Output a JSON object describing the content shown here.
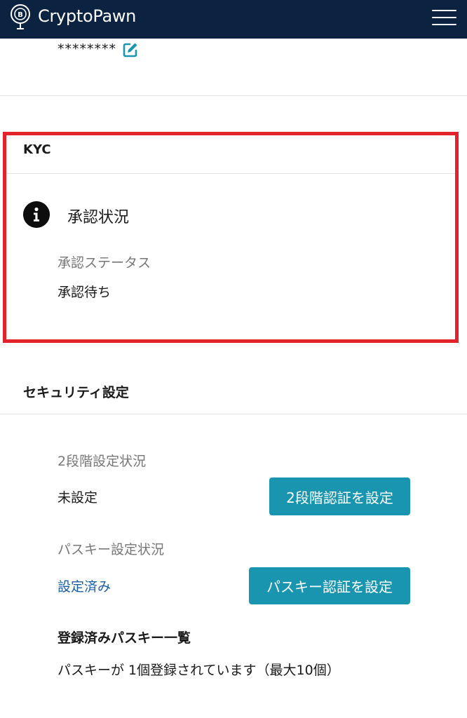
{
  "header": {
    "brand": "CryptoPawn",
    "logo_icon": "pawn-coin-logo-icon",
    "menu_icon": "hamburger-menu-icon",
    "background": "#0b2340"
  },
  "account": {
    "password_mask": "********",
    "edit_icon": "edit-pencil-icon"
  },
  "kyc": {
    "title": "KYC",
    "status_icon": "info-icon",
    "approval_heading": "承認状況",
    "approval_status_label": "承認ステータス",
    "approval_status_value": "承認待ち",
    "highlight_color": "#e3232c"
  },
  "security": {
    "title": "セキュリティ設定",
    "two_factor_label": "2段階設定状況",
    "two_factor_value": "未設定",
    "two_factor_button": "2段階認証を設定",
    "passkey_label": "パスキー設定状況",
    "passkey_value": "設定済み",
    "passkey_button": "パスキー認証を設定",
    "registered_title": "登録済みパスキー一覧",
    "registered_text": "パスキーが 1個登録されています（最大10個）",
    "button_color": "#1a95b0",
    "link_color": "#1a5ea3"
  }
}
